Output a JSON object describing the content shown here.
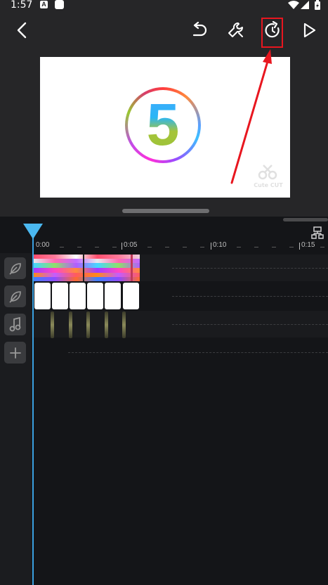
{
  "status_bar": {
    "time": "1:57",
    "notif_a": "A"
  },
  "toolbar": {
    "back_icon": "chevron-left-icon",
    "undo_icon": "undo-icon",
    "tools_icon": "wrench-icon",
    "redo_icon": "redo-icon",
    "play_icon": "play-icon"
  },
  "preview": {
    "number": "5",
    "watermark": "Cute CUT"
  },
  "timeline": {
    "ticks": [
      "0:00",
      "0:05",
      "0:10",
      "0:15"
    ],
    "tracks": [
      {
        "icon": "leaf-icon"
      },
      {
        "icon": "leaf-icon"
      },
      {
        "icon": "music-note-icon"
      },
      {
        "icon": "plus-icon"
      }
    ]
  },
  "colors": {
    "highlight": "#e8161f",
    "playhead": "#4bb8f0",
    "arrow": "#e8161f"
  }
}
